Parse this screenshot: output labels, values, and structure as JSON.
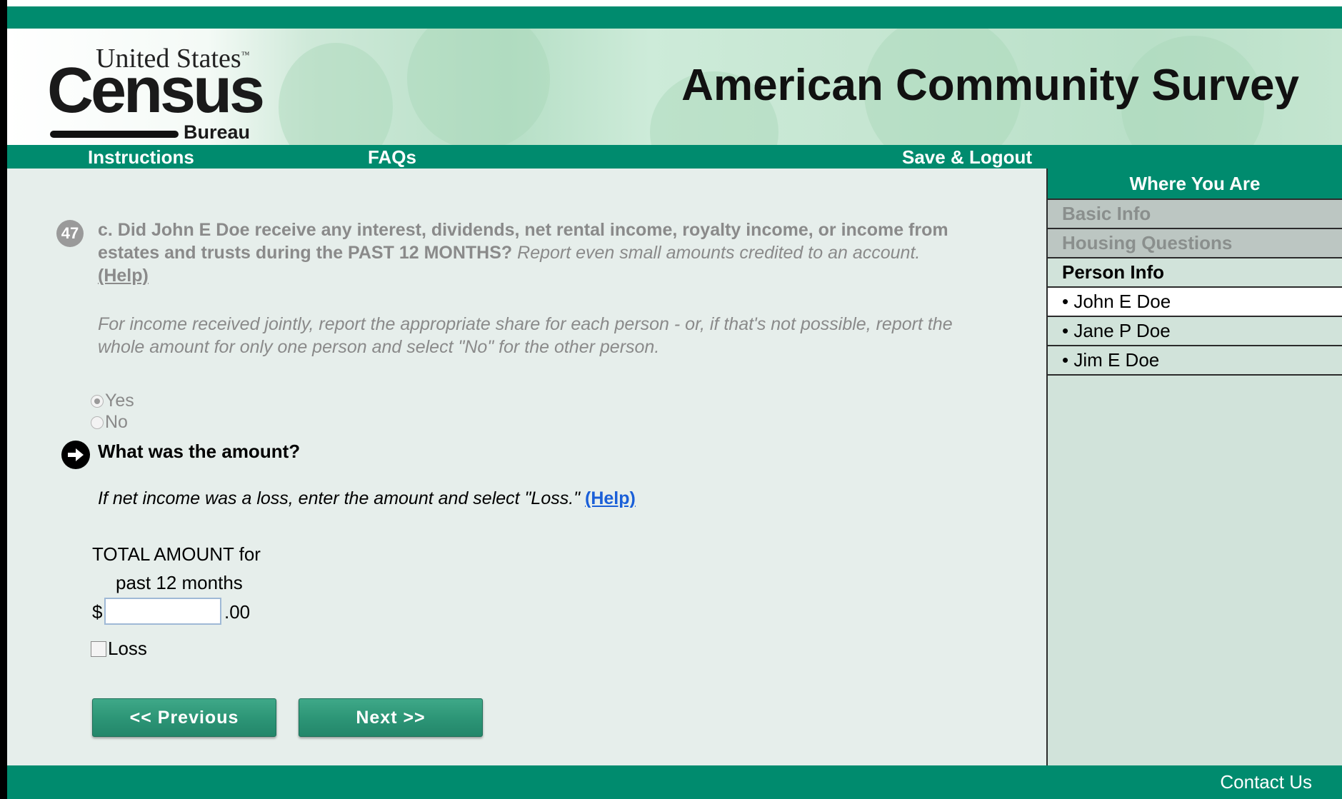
{
  "header": {
    "logo": {
      "line1": "United States",
      "tm": "™",
      "line2": "Census",
      "line3": "Bureau"
    },
    "title": "American Community Survey"
  },
  "nav": {
    "instructions": "Instructions",
    "faqs": "FAQs",
    "save_logout": "Save & Logout"
  },
  "question": {
    "number": "47",
    "text_bold": "c. Did John E Doe receive any interest, dividends, net rental income, royalty income, or income from estates and trusts during the PAST 12 MONTHS?",
    "text_italic": "Report even small amounts credited to an account.",
    "help": "(Help)",
    "note": "For income received jointly, report the appropriate share for each person - or, if that's not possible, report the whole amount for only one person and select \"No\" for the other person.",
    "options": [
      {
        "label": "Yes",
        "selected": true
      },
      {
        "label": "No",
        "selected": false
      }
    ]
  },
  "amount": {
    "question": "What was the amount?",
    "loss_note": "If net income was a loss, enter the amount and select \"Loss.\"",
    "help": "(Help)",
    "total_label_1": "TOTAL AMOUNT for",
    "total_label_2": "past 12 months",
    "currency": "$",
    "value": "",
    "cents": ".00",
    "loss_label": "Loss",
    "loss_checked": false
  },
  "buttons": {
    "previous": "<<   Previous",
    "next": "Next   >>"
  },
  "sidebar": {
    "title": "Where You Are",
    "items": [
      {
        "label": "Basic Info",
        "state": "done"
      },
      {
        "label": "Housing Questions",
        "state": "done"
      },
      {
        "label": "Person Info",
        "state": "section"
      },
      {
        "label": "• John E Doe",
        "state": "current"
      },
      {
        "label": "• Jane P Doe",
        "state": "person"
      },
      {
        "label": "• Jim E Doe",
        "state": "person"
      }
    ]
  },
  "footer": {
    "contact": "Contact Us"
  },
  "colors": {
    "brand_green": "#008b6e",
    "help_link": "#1a5fd8"
  }
}
